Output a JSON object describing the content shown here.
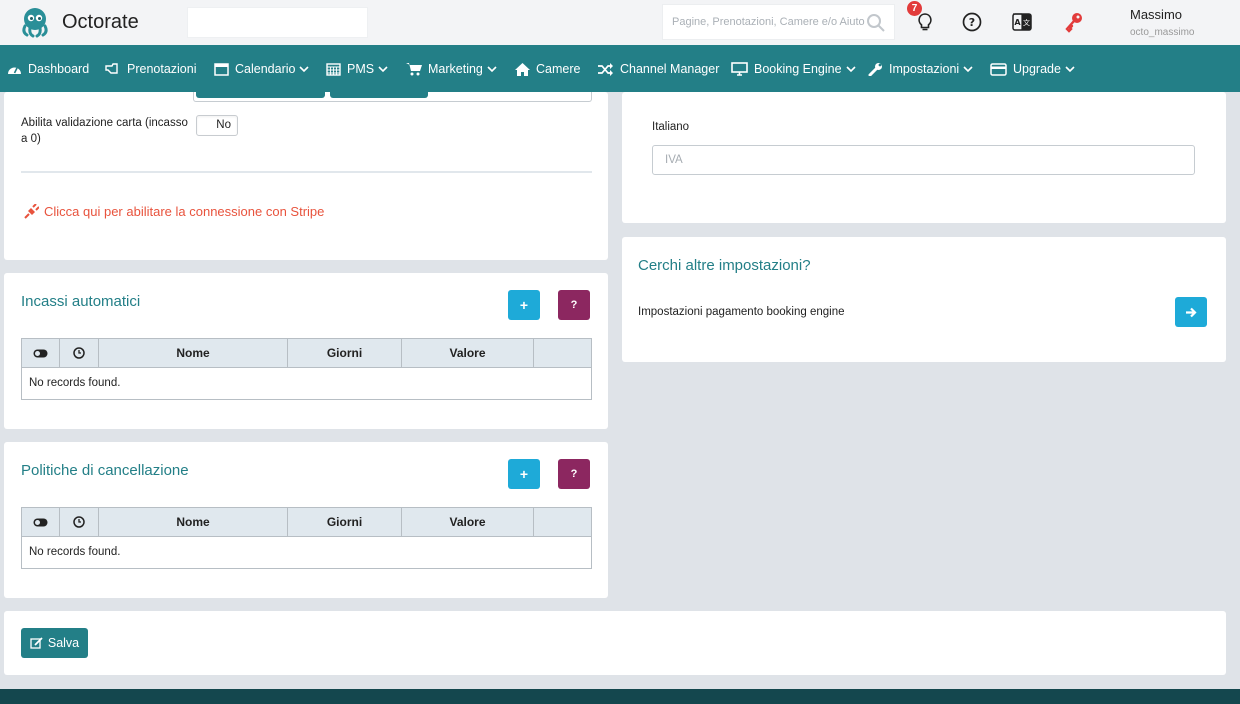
{
  "header": {
    "brand": "Octorate",
    "search_placeholder": "Pagine, Prenotazioni, Camere e/o Aiuto",
    "notification_count": "7",
    "user_name": "Massimo",
    "user_id": "octo_massimo"
  },
  "nav": {
    "dashboard": "Dashboard",
    "prenotazioni": "Prenotazioni",
    "calendario": "Calendario",
    "pms": "PMS",
    "marketing": "Marketing",
    "camere": "Camere",
    "channel_manager": "Channel Manager",
    "booking_engine": "Booking Engine",
    "impostazioni": "Impostazioni",
    "upgrade": "Upgrade"
  },
  "payment": {
    "card_validation_label": "Abilita validazione carta (incasso a 0)",
    "card_validation_value": "No",
    "stripe_link": "Clicca qui per abilitare la connessione con Stripe"
  },
  "incassi": {
    "title": "Incassi automatici",
    "add_label": "+",
    "help_label": "?",
    "columns": [
      "Nome",
      "Giorni",
      "Valore"
    ],
    "empty": "No records found."
  },
  "politiche": {
    "title": "Politiche di cancellazione",
    "add_label": "+",
    "help_label": "?",
    "columns": [
      "Nome",
      "Giorni",
      "Valore"
    ],
    "empty": "No records found."
  },
  "language": {
    "label": "Italiano",
    "placeholder": "IVA"
  },
  "more_settings": {
    "title": "Cerchi altre impostazioni?",
    "link_text": "Impostazioni pagamento booking engine"
  },
  "actions": {
    "save": "Salva"
  },
  "colors": {
    "nav": "#237f87",
    "accent_blue": "#1eaad8",
    "accent_purple": "#8c2760",
    "stripe_red": "#e8533d",
    "footer": "#14474e"
  }
}
